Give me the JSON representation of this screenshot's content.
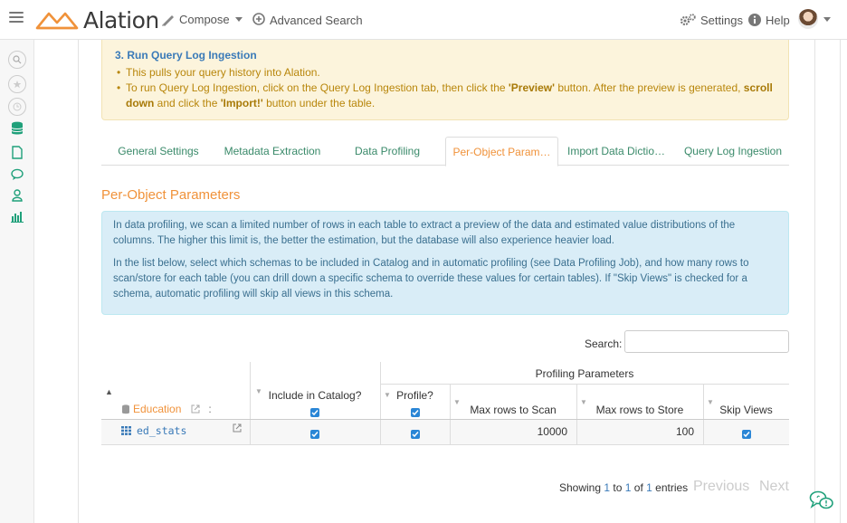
{
  "header": {
    "logo_text": "Alation",
    "compose_label": "Compose",
    "advanced_search_label": "Advanced Search",
    "settings_label": "Settings",
    "help_label": "Help"
  },
  "warning": {
    "title": "3. Run Query Log Ingestion",
    "bullet1": "This pulls your query history into Alation.",
    "bullet2_a": "To run Query Log Ingestion, click on the Query Log Ingestion tab, then click the ",
    "bullet2_preview": "'Preview'",
    "bullet2_b": " button. After the preview is generated, ",
    "bullet2_scroll": "scroll",
    "bullet2_down": "down",
    "bullet2_c": " and click the ",
    "bullet2_import": "'Import!'",
    "bullet2_d": " button under the table."
  },
  "tabs": [
    {
      "label": "General Settings"
    },
    {
      "label": "Metadata Extraction"
    },
    {
      "label": "Data Profiling"
    },
    {
      "label": "Per-Object Param…"
    },
    {
      "label": "Import Data Dictio…"
    },
    {
      "label": "Query Log Ingestion"
    }
  ],
  "section_title": "Per-Object Parameters",
  "info": {
    "para1": "In data profiling, we scan a limited number of rows in each table to extract a preview of the data and estimated value distributions of the columns. The higher this limit is, the better the estimation, but the database will also experience heavier load.",
    "para2": "In the list below, select which schemas to be included in Catalog and in automatic profiling (see Data Profiling Job), and how many rows to scan/store for each table (you can drill down a specific schema to override these values for certain tables). If \"Skip Views\" is checked for a schema, automatic profiling will skip all views in this schema."
  },
  "search": {
    "label": "Search:",
    "value": ""
  },
  "table": {
    "group_header": "Profiling Parameters",
    "col_db": "Education",
    "col_db_extra": ":",
    "col_catalog": "Include in Catalog?",
    "col_profile": "Profile?",
    "col_scan": "Max rows to Scan",
    "col_store": "Max rows to Store",
    "col_skip": "Skip Views",
    "rows": [
      {
        "name": "ed_stats",
        "include": true,
        "profile": true,
        "scan": "10000",
        "store": "100",
        "skip": true
      }
    ]
  },
  "footer": {
    "showing_a": "Showing ",
    "from": "1",
    "to_word": " to ",
    "to": "1",
    "of_word": " of ",
    "total": "1",
    "entries": " entries",
    "prev": "Previous",
    "next": "Next"
  },
  "colors": {
    "accent_orange": "#f0923a",
    "link_blue": "#3a7ab8",
    "tab_green": "#3a8a6a",
    "checkbox_blue": "#2a86d6"
  }
}
